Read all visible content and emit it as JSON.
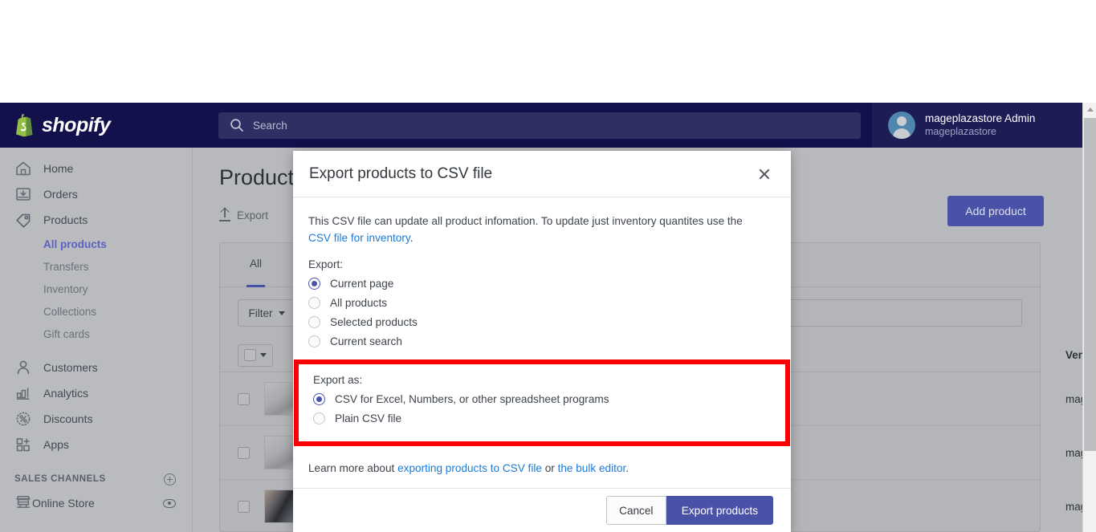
{
  "topbar": {
    "brand": "shopify",
    "search_placeholder": "Search",
    "account_name": "mageplazastore Admin",
    "account_store": "mageplazastore"
  },
  "sidebar": {
    "items": [
      {
        "label": "Home",
        "icon": "home-icon"
      },
      {
        "label": "Orders",
        "icon": "orders-icon"
      },
      {
        "label": "Products",
        "icon": "products-tag-icon"
      }
    ],
    "product_sub_items": [
      {
        "label": "All products",
        "active": true
      },
      {
        "label": "Transfers",
        "active": false
      },
      {
        "label": "Inventory",
        "active": false
      },
      {
        "label": "Collections",
        "active": false
      },
      {
        "label": "Gift cards",
        "active": false
      }
    ],
    "items_lower": [
      {
        "label": "Customers",
        "icon": "customer-icon"
      },
      {
        "label": "Analytics",
        "icon": "analytics-bars-icon"
      },
      {
        "label": "Discounts",
        "icon": "discount-percent-icon"
      },
      {
        "label": "Apps",
        "icon": "apps-grid-icon"
      }
    ],
    "sales_channels_header": "SALES CHANNELS",
    "online_store": "Online Store"
  },
  "main": {
    "page_title": "Products",
    "export_label": "Export",
    "add_product_label": "Add product",
    "tabs": [
      {
        "label": "All",
        "active": true
      }
    ],
    "filter_label": "Filter",
    "table_columns": [
      "Vendor"
    ],
    "rows": [
      {
        "vendor": "mageplazastore"
      },
      {
        "vendor": "mageplazastore"
      },
      {
        "vendor": "mageplazastore"
      }
    ]
  },
  "modal": {
    "title": "Export products to CSV file",
    "intro_part1": "This CSV file can update all product infomation. To update just inventory quantites use the ",
    "intro_link": "CSV file for inventory",
    "intro_part2": ".",
    "export_label": "Export:",
    "export_options": [
      {
        "label": "Current page",
        "selected": true
      },
      {
        "label": "All products",
        "selected": false
      },
      {
        "label": "Selected products",
        "selected": false
      },
      {
        "label": "Current search",
        "selected": false
      }
    ],
    "export_as_label": "Export as:",
    "export_as_options": [
      {
        "label": "CSV for Excel, Numbers, or other spreadsheet programs",
        "selected": true
      },
      {
        "label": "Plain CSV file",
        "selected": false
      }
    ],
    "learn_more_prefix": "Learn more about ",
    "learn_more_link1": "exporting products to CSV file",
    "learn_more_middle": " or ",
    "learn_more_link2": "the bulk editor",
    "learn_more_suffix": ".",
    "cancel_label": "Cancel",
    "submit_label": "Export products"
  },
  "highlight": {
    "color": "#fa0000",
    "target": "export-as-radio-group"
  },
  "colors": {
    "brand_navy": "#12114c",
    "accent_purple": "#4a52a8",
    "link_blue": "#1a7ad9",
    "highlight_red": "#fa0000"
  }
}
